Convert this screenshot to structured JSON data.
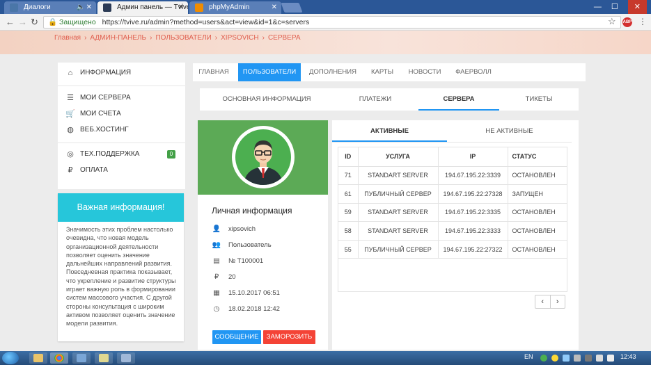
{
  "browser": {
    "tabs": [
      {
        "label": "Диалоги",
        "icon_color": "#4a76a8"
      },
      {
        "label": "Админ панель — Tvive.I",
        "icon_color": "#2b3a55"
      },
      {
        "label": "phpMyAdmin",
        "icon_color": "#f08c00"
      }
    ],
    "secure_label": "Защищено",
    "url": "https://tvive.ru/admin?method=users&act=view&id=1&c=servers",
    "abp_label": "ABP"
  },
  "breadcrumbs": [
    "Главная",
    "АДМИН-ПАНЕЛЬ",
    "ПОЛЬЗОВАТЕЛИ",
    "XIPSOVICH",
    "СЕРВЕРА"
  ],
  "sidebar": {
    "items": [
      {
        "label": "ИНФОРМАЦИЯ",
        "icon": "home-icon",
        "glyph": "⌂"
      },
      {
        "label": "МОИ СЕРВЕРА",
        "icon": "server-icon",
        "glyph": "☰"
      },
      {
        "label": "МОИ СЧЕТА",
        "icon": "cart-icon",
        "glyph": "🛒"
      },
      {
        "label": "ВЕБ.ХОСТИНГ",
        "icon": "globe-icon",
        "glyph": "◍"
      },
      {
        "label": "ТЕХ.ПОДДЕРЖКА",
        "icon": "lifebuoy-icon",
        "glyph": "◎",
        "badge": "0"
      },
      {
        "label": "ОПЛАТА",
        "icon": "ruble-icon",
        "glyph": "₽"
      }
    ]
  },
  "infobox": {
    "title": "Важная информация!",
    "text": "Значимость этих проблем настолько очевидна, что новая модель организационной деятельности позволяет оценить значение дальнейших направлений развития. Повседневная практика показывает, что укрепление и развитие структуры играет важную роль в формировании систем массового участия. С другой стороны консультация с широким активом позволяет оценить значение модели развития."
  },
  "topnav": [
    "ГЛАВНАЯ",
    "ПОЛЬЗОВАТЕЛИ",
    "ДОПОЛНЕНИЯ",
    "КАРТЫ",
    "НОВОСТИ",
    "ФАЕРВОЛЛ"
  ],
  "subnav": [
    "ОСНОВНАЯ ИНФОРМАЦИЯ",
    "ПЛАТЕЖИ",
    "СЕРВЕРА",
    "ТИКЕТЫ"
  ],
  "profile": {
    "title": "Личная информация",
    "rows": [
      {
        "icon": "user-icon",
        "glyph": "👤",
        "value": "xipsovich"
      },
      {
        "icon": "users-icon",
        "glyph": "👥",
        "value": "Пользователь"
      },
      {
        "icon": "id-card-icon",
        "glyph": "▤",
        "value": "№ T100001"
      },
      {
        "icon": "ruble-icon",
        "glyph": "₽",
        "value": "20"
      },
      {
        "icon": "calendar-icon",
        "glyph": "▦",
        "value": "15.10.2017 06:51"
      },
      {
        "icon": "clock-icon",
        "glyph": "◷",
        "value": "18.02.2018 12:42"
      }
    ],
    "message_button": "СООБЩЕНИЕ",
    "freeze_button": "ЗАМОРОЗИТЬ"
  },
  "servers": {
    "tabs": [
      "АКТИВНЫЕ",
      "НЕ АКТИВНЫЕ"
    ],
    "columns": [
      "ID",
      "УСЛУГА",
      "IP",
      "СТАТУС"
    ],
    "rows": [
      [
        "71",
        "STANDART SERVER",
        "194.67.195.22:3339",
        "ОСТАНОВЛЕН"
      ],
      [
        "61",
        "ПУБЛИЧНЫЙ СЕРВЕР",
        "194.67.195.22:27328",
        "ЗАПУЩЕН"
      ],
      [
        "59",
        "STANDART SERVER",
        "194.67.195.22:3335",
        "ОСТАНОВЛЕН"
      ],
      [
        "58",
        "STANDART SERVER",
        "194.67.195.22:3333",
        "ОСТАНОВЛЕН"
      ],
      [
        "55",
        "ПУБЛИЧНЫЙ СЕРВЕР",
        "194.67.195.22:27322",
        "ОСТАНОВЛЕН"
      ]
    ],
    "pager_prev": "‹",
    "pager_next": "›"
  },
  "taskbar": {
    "lang": "EN",
    "time": "12:43"
  },
  "colors": {
    "accent": "#2196f3",
    "danger": "#f44336",
    "info_header": "#26c6da",
    "cover": "#5caa56",
    "badge": "#43a047"
  }
}
